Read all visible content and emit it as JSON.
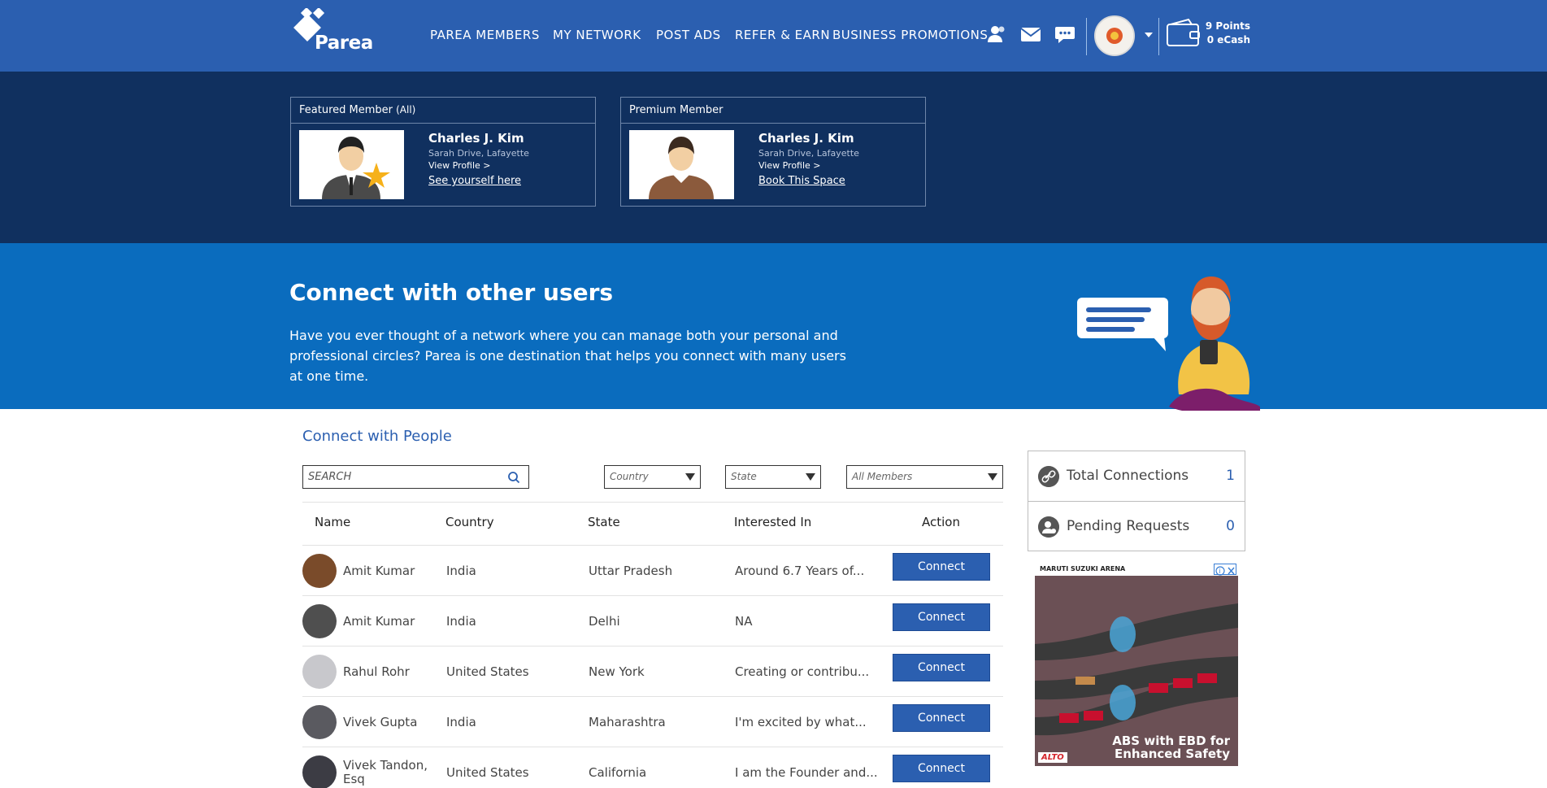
{
  "header": {
    "logo_text": "Parea",
    "nav": [
      "PAREA MEMBERS",
      "MY NETWORK",
      "POST ADS",
      "REFER & EARN",
      "BUSINESS PROMOTIONS"
    ],
    "wallet": {
      "points": "9 Points",
      "ecash": "0 eCash"
    },
    "icons": [
      "friends-icon",
      "mail-icon",
      "chat-icon",
      "profile-avatar",
      "wallet-icon"
    ]
  },
  "featured": [
    {
      "heading": "Featured Member",
      "heading_suffix": "(All)",
      "name": "Charles J. Kim",
      "address": "Sarah Drive, Lafayette",
      "view": "View Profile >",
      "link": "See yourself here"
    },
    {
      "heading": "Premium Member",
      "heading_suffix": "",
      "name": "Charles J. Kim",
      "address": "Sarah Drive, Lafayette",
      "view": "View Profile >",
      "link": "Book This Space"
    }
  ],
  "hero": {
    "title": "Connect with other users",
    "text": "Have you ever thought of a network where you can manage both your personal and professional circles? Parea is one destination that helps you connect with many users at one time."
  },
  "connect": {
    "title": "Connect with People",
    "search_placeholder": "SEARCH",
    "filters": [
      "Country",
      "State",
      "All Members"
    ],
    "columns": [
      "Name",
      "Country",
      "State",
      "Interested In",
      "Action"
    ],
    "rows": [
      {
        "name": "Amit Kumar",
        "country": "India",
        "state": "Uttar Pradesh",
        "interest": "Around 6.7 Years of...",
        "action": "Connect"
      },
      {
        "name": "Amit Kumar",
        "country": "India",
        "state": "Delhi",
        "interest": "NA",
        "action": "Connect"
      },
      {
        "name": "Rahul Rohr",
        "country": "United States",
        "state": "New York",
        "interest": "Creating or contribu...",
        "action": "Connect"
      },
      {
        "name": "Vivek Gupta",
        "country": "India",
        "state": "Maharashtra",
        "interest": "I'm excited by what...",
        "action": "Connect"
      },
      {
        "name": "Vivek Tandon, Esq",
        "country": "United States",
        "state": "California",
        "interest": "I am the Founder and...",
        "action": "Connect"
      }
    ]
  },
  "sidebar": {
    "total_connections": {
      "label": "Total Connections",
      "value": "1"
    },
    "pending_requests": {
      "label": "Pending Requests",
      "value": "0"
    }
  },
  "ad": {
    "brand_head": "MARUTI SUZUKI ARENA",
    "tagline_1": "ABS with EBD for",
    "tagline_2": "Enhanced Safety",
    "product": "ALTO"
  }
}
